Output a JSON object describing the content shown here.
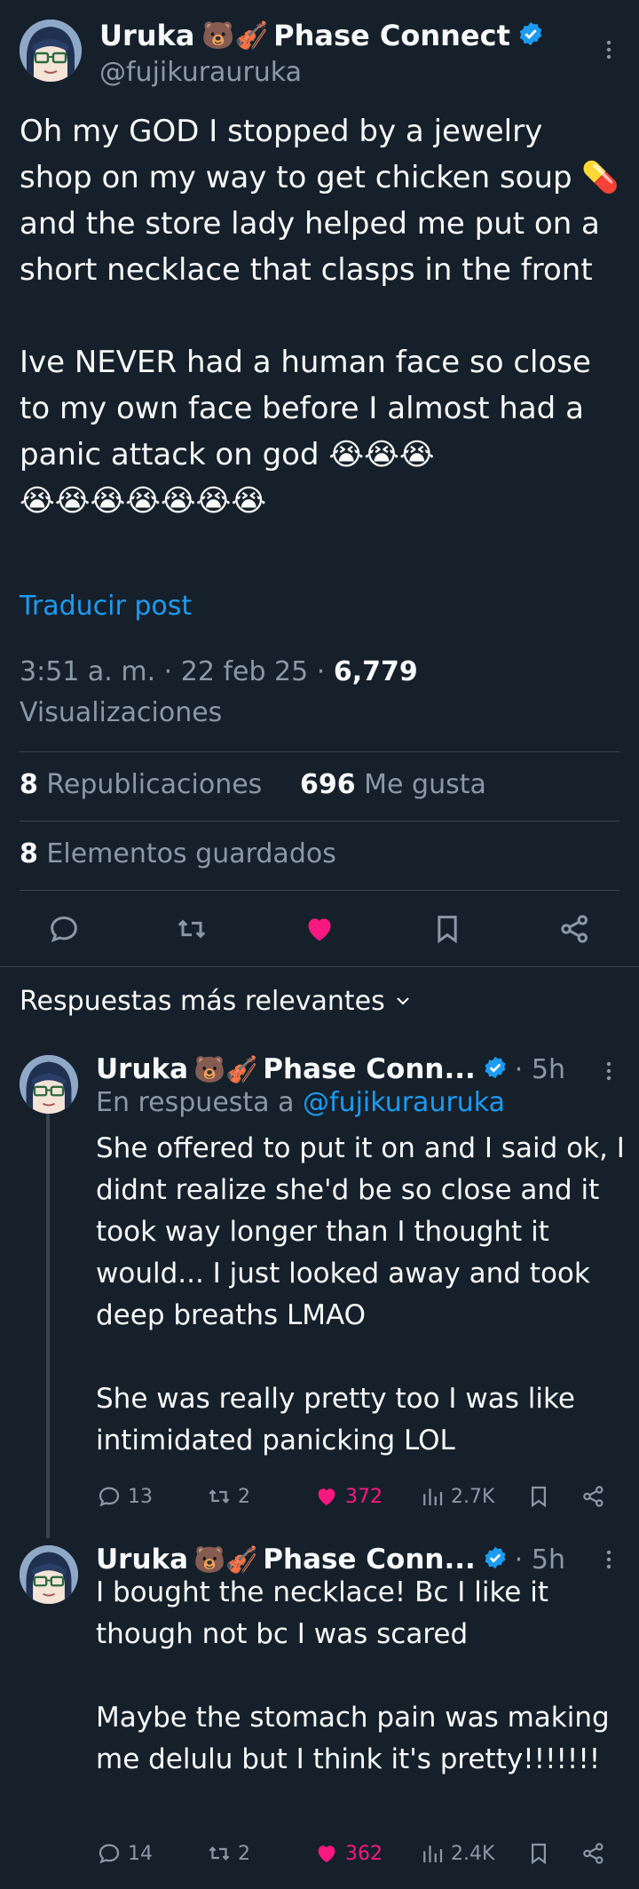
{
  "colors": {
    "background": "#15202b",
    "accent": "#1d9bf0",
    "like": "#f91880",
    "muted": "#8b98a5"
  },
  "post": {
    "display_name": "Uruka",
    "name_emojis": "🐻🎻",
    "display_name_suffix": "Phase Connect",
    "handle": "@fujikurauruka",
    "text": "Oh my GOD I stopped by a jewelry shop on my way to get chicken soup 💊  and the store lady helped me put on a short necklace that clasps in the front\n\nIve NEVER had a human face so close to my own face before I almost had a panic attack on god 😭😭😭\n😭😭😭😭😭😭😭",
    "translate": "Traducir post",
    "time": "3:51 a. m. · 22 feb 25 · ",
    "views_count": "6,779",
    "views_label": "Visualizaciones",
    "reposts_count": "8",
    "reposts_label": "Republicaciones",
    "likes_count": "696",
    "likes_label": "Me gusta",
    "bookmarks_count": "8",
    "bookmarks_label": "Elementos guardados",
    "actions": [
      "reply-icon",
      "repost-icon",
      "heart-filled-icon",
      "bookmark-icon",
      "share-icon"
    ]
  },
  "sort_label": "Respuestas más relevantes",
  "replies": [
    {
      "display_name": "Uruka",
      "name_emojis": "🐻🎻",
      "display_name_suffix": "Phase Conn...",
      "age": "· 5h",
      "reply_to_prefix": "En respuesta a ",
      "reply_to_handle": "@fujikurauruka",
      "text": "She offered to put it on and I said ok, I didnt realize she'd be so close and it took way longer than I thought it would... I just looked away and took deep breaths LMAO\n\nShe was really pretty too I was like intimidated panicking LOL",
      "replies": "13",
      "reposts": "2",
      "likes": "372",
      "views": "2.7K"
    },
    {
      "display_name": "Uruka",
      "name_emojis": "🐻🎻",
      "display_name_suffix": "Phase Conn...",
      "age": "· 5h",
      "text": "I bought the necklace! Bc I like it though not bc I was scared\n\nMaybe the stomach pain was making me delulu but I think it's pretty!!!!!!!",
      "replies": "14",
      "reposts": "2",
      "likes": "362",
      "views": "2.4K"
    }
  ]
}
